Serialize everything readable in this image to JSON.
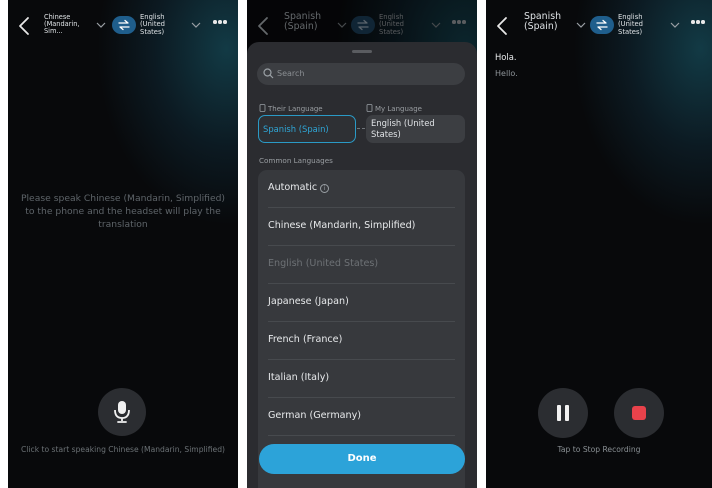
{
  "screen1": {
    "header": {
      "source_language": "Chinese (Mandarin, Sim...",
      "target_language": "English (United States)"
    },
    "message": "Please speak Chinese (Mandarin, Simplified) to the phone and the headset will play the translation",
    "bottom_hint": "Click to start speaking Chinese (Mandarin, Simplified)"
  },
  "screen2": {
    "header": {
      "source_language": "Spanish (Spain)",
      "target_language": "English (United States)"
    },
    "search_placeholder": "Search",
    "their_language_label": "Their Language",
    "my_language_label": "My Language",
    "their_language_value": "Spanish (Spain)",
    "my_language_value": "English (United States)",
    "common_languages_label": "Common Languages",
    "languages": [
      "Automatic",
      "Chinese (Mandarin, Simplified)",
      "English (United States)",
      "Japanese (Japan)",
      "French (France)",
      "Italian (Italy)",
      "German (Germany)"
    ],
    "done_label": "Done"
  },
  "screen3": {
    "header": {
      "source_language": "Spanish (Spain)",
      "target_language": "English (United States)"
    },
    "original_text": "Hola.",
    "translated_text": "Hello.",
    "stop_hint": "Tap to Stop Recording"
  },
  "colors": {
    "accent": "#2ca3d9",
    "swap_button": "#1f5e8c",
    "stop_red": "#e8424b"
  }
}
